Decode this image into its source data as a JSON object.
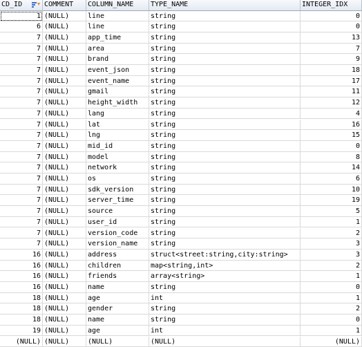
{
  "columns": [
    "CD_ID",
    "COMMENT",
    "COLUMN_NAME",
    "TYPE_NAME",
    "INTEGER_IDX"
  ],
  "rows": [
    [
      "1",
      "(NULL)",
      "line",
      "string",
      "0"
    ],
    [
      "6",
      "(NULL)",
      "line",
      "string",
      "0"
    ],
    [
      "7",
      "(NULL)",
      "app_time",
      "string",
      "13"
    ],
    [
      "7",
      "(NULL)",
      "area",
      "string",
      "7"
    ],
    [
      "7",
      "(NULL)",
      "brand",
      "string",
      "9"
    ],
    [
      "7",
      "(NULL)",
      "event_json",
      "string",
      "18"
    ],
    [
      "7",
      "(NULL)",
      "event_name",
      "string",
      "17"
    ],
    [
      "7",
      "(NULL)",
      "gmail",
      "string",
      "11"
    ],
    [
      "7",
      "(NULL)",
      "height_width",
      "string",
      "12"
    ],
    [
      "7",
      "(NULL)",
      "lang",
      "string",
      "4"
    ],
    [
      "7",
      "(NULL)",
      "lat",
      "string",
      "16"
    ],
    [
      "7",
      "(NULL)",
      "lng",
      "string",
      "15"
    ],
    [
      "7",
      "(NULL)",
      "mid_id",
      "string",
      "0"
    ],
    [
      "7",
      "(NULL)",
      "model",
      "string",
      "8"
    ],
    [
      "7",
      "(NULL)",
      "network",
      "string",
      "14"
    ],
    [
      "7",
      "(NULL)",
      "os",
      "string",
      "6"
    ],
    [
      "7",
      "(NULL)",
      "sdk_version",
      "string",
      "10"
    ],
    [
      "7",
      "(NULL)",
      "server_time",
      "string",
      "19"
    ],
    [
      "7",
      "(NULL)",
      "source",
      "string",
      "5"
    ],
    [
      "7",
      "(NULL)",
      "user_id",
      "string",
      "1"
    ],
    [
      "7",
      "(NULL)",
      "version_code",
      "string",
      "2"
    ],
    [
      "7",
      "(NULL)",
      "version_name",
      "string",
      "3"
    ],
    [
      "16",
      "(NULL)",
      "address",
      "struct<street:string,city:string>",
      "3"
    ],
    [
      "16",
      "(NULL)",
      "children",
      "map<string,int>",
      "2"
    ],
    [
      "16",
      "(NULL)",
      "friends",
      "array<string>",
      "1"
    ],
    [
      "16",
      "(NULL)",
      "name",
      "string",
      "0"
    ],
    [
      "18",
      "(NULL)",
      "age",
      "int",
      "1"
    ],
    [
      "18",
      "(NULL)",
      "gender",
      "string",
      "2"
    ],
    [
      "18",
      "(NULL)",
      "name",
      "string",
      "0"
    ],
    [
      "19",
      "(NULL)",
      "age",
      "int",
      "1"
    ],
    [
      "(NULL)",
      "(NULL)",
      "(NULL)",
      "(NULL)",
      "(NULL)"
    ]
  ],
  "header_icon": "sort-filter-icon",
  "colors": {
    "header_bg": "#e4eaf2",
    "grid_line": "#d9d9d9"
  }
}
